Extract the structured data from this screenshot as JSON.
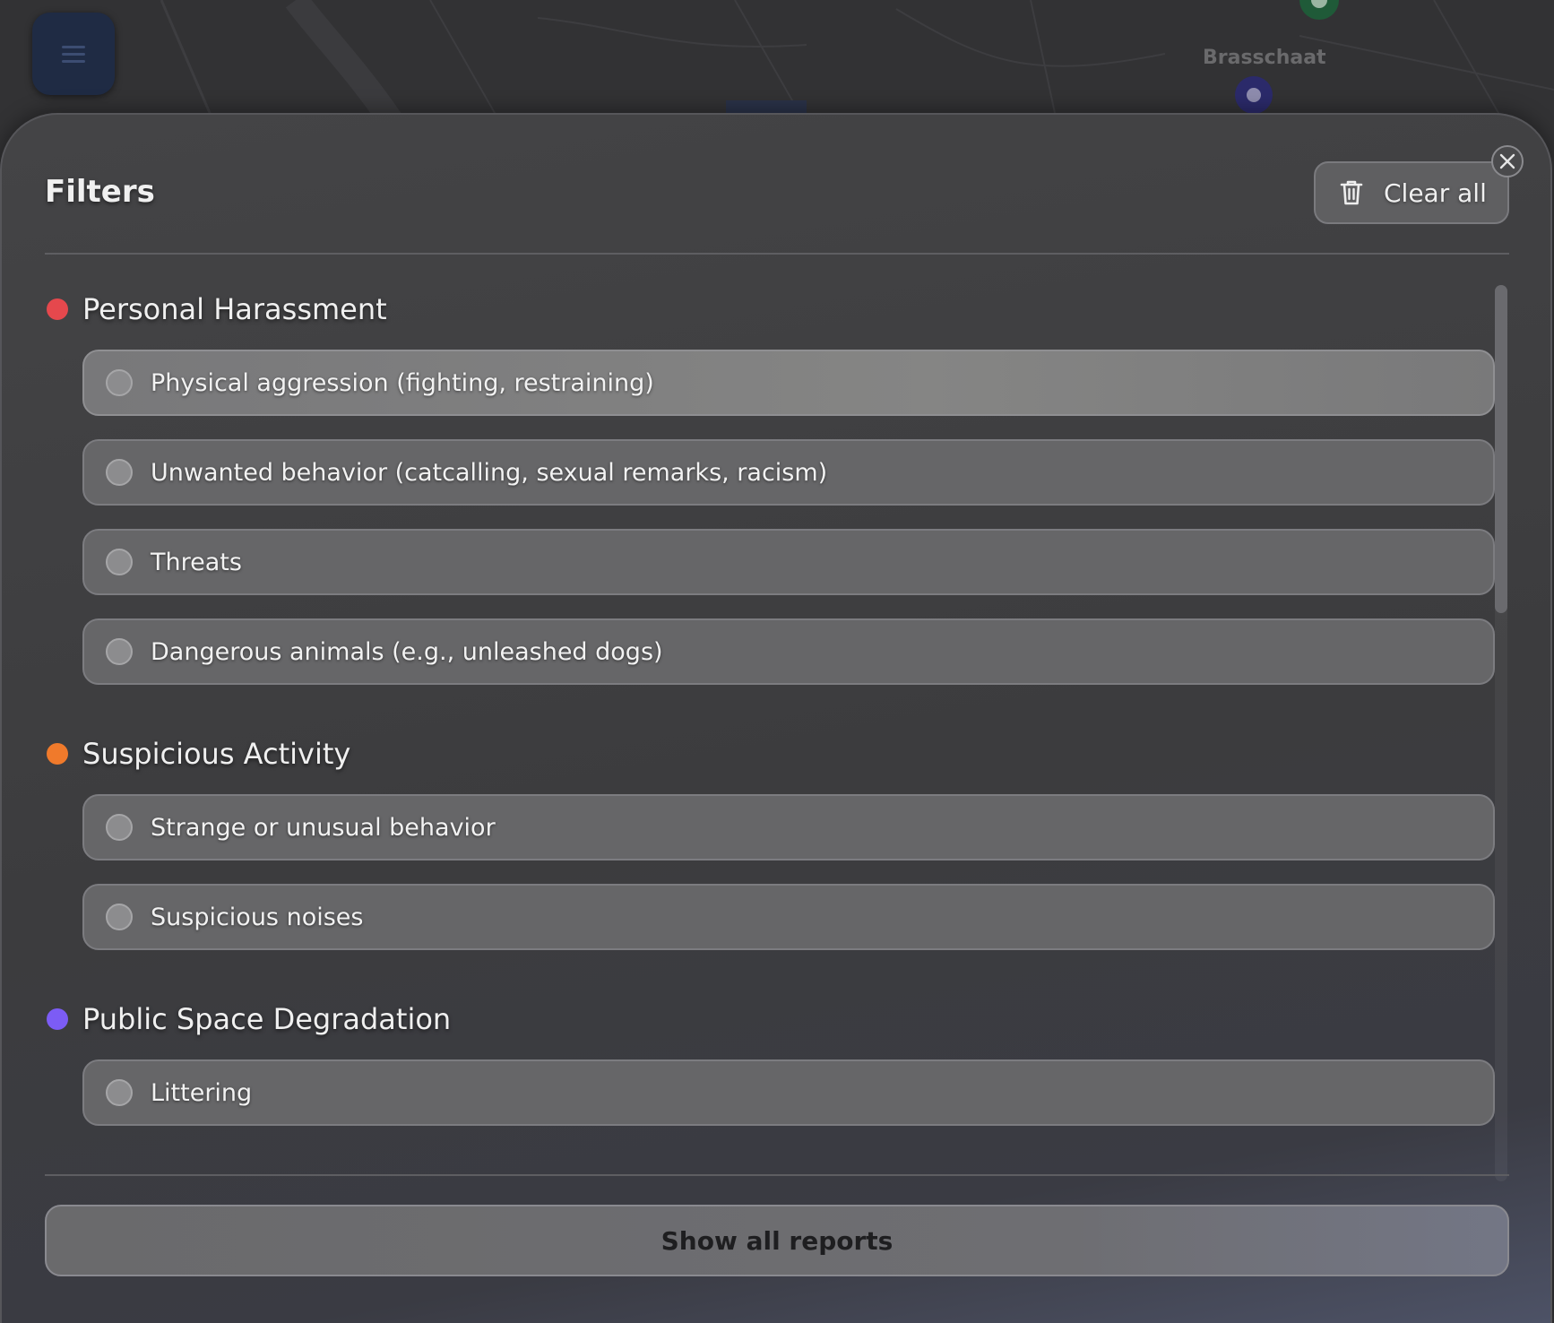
{
  "map": {
    "place_label": "Brasschaat",
    "menu_icon": "hamburger-menu-icon"
  },
  "filters": {
    "title": "Filters",
    "clear_all_label": "Clear all",
    "clear_icon": "trash-icon",
    "close_icon": "close-icon",
    "categories": [
      {
        "label": "Personal Harassment",
        "color": "#e5484d",
        "options": [
          {
            "label": "Physical aggression (fighting, restraining)",
            "selected": false
          },
          {
            "label": "Unwanted behavior (catcalling, sexual remarks, racism)",
            "selected": false
          },
          {
            "label": "Threats",
            "selected": false
          },
          {
            "label": "Dangerous animals (e.g., unleashed dogs)",
            "selected": false
          }
        ]
      },
      {
        "label": "Suspicious Activity",
        "color": "#f07a2b",
        "options": [
          {
            "label": "Strange or unusual behavior",
            "selected": false
          },
          {
            "label": "Suspicious noises",
            "selected": false
          }
        ]
      },
      {
        "label": "Public Space Degradation",
        "color": "#7c5cf5",
        "options": [
          {
            "label": "Littering",
            "selected": false
          }
        ]
      }
    ],
    "show_all_label": "Show all reports"
  }
}
